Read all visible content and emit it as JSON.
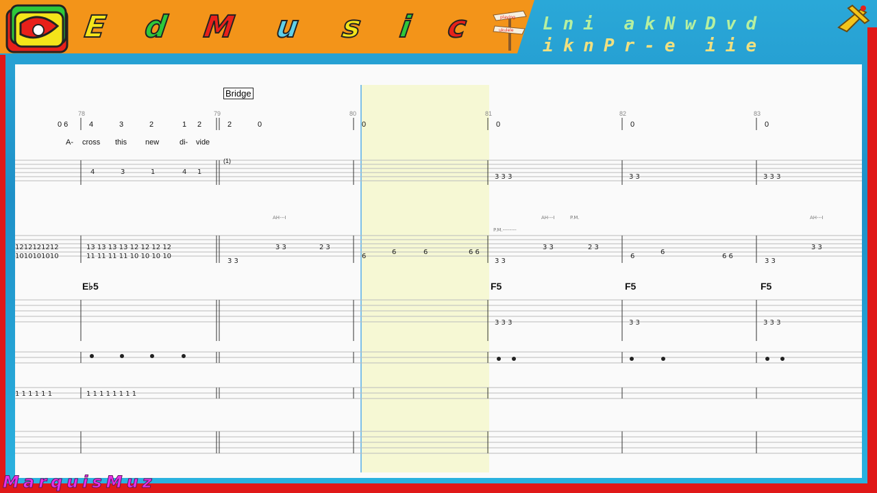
{
  "header": {
    "title_letters": [
      "E",
      "d",
      "M",
      "u",
      "s",
      "i",
      "c"
    ],
    "title_colors": [
      "#f4e41a",
      "#2ec83a",
      "#e8201a",
      "#5fd0e8",
      "#f4e41a",
      "#2ec83a",
      "#e8201a"
    ],
    "sign_labels": [
      "playing",
      "ukulele"
    ],
    "subtitle_line1": "Lni akNwDvd",
    "subtitle_line2": "iknPr-e iie"
  },
  "score": {
    "section_label": "Bridge",
    "bar_numbers": [
      "78",
      "79",
      "80",
      "81",
      "82",
      "83"
    ],
    "lyrics": [
      "A-",
      "cross",
      "this",
      "new",
      "di-",
      "vide"
    ],
    "chords": [
      "E♭5",
      "F5",
      "F5",
      "F5"
    ],
    "vocal_tab_numbers": [
      "0 6",
      "4",
      "3",
      "2",
      "1",
      "2",
      "2",
      "0",
      "0",
      "0",
      "0",
      "0"
    ],
    "vocal_tied_note": "(1)",
    "guitar_annotations": [
      "AH---I",
      "½",
      "P.M.--------",
      "AH---I",
      "P.M.",
      "½",
      "AH---I",
      "½"
    ]
  },
  "footer": {
    "watermark": "MarquisMuz"
  },
  "colors": {
    "orange_bar": "#f39419",
    "frame_blue": "#1e90c8",
    "frame_red": "#e01818",
    "highlight": "#f6f8d4",
    "cursor": "#7ec0e8"
  }
}
